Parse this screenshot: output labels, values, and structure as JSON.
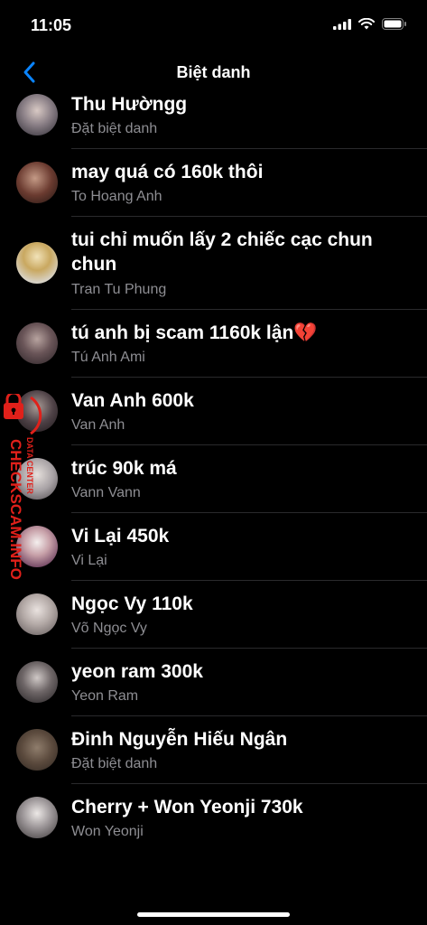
{
  "status_bar": {
    "time": "11:05"
  },
  "header": {
    "title": "Biệt danh"
  },
  "contacts": [
    {
      "nickname": "Thu Hườngg",
      "subtitle": "Đặt biệt danh"
    },
    {
      "nickname": "may quá có 160k thôi",
      "subtitle": "To Hoang Anh"
    },
    {
      "nickname": "tui chỉ muốn lấy 2 chiếc cạc chun chun",
      "subtitle": "Tran Tu Phung"
    },
    {
      "nickname": "tú anh bị scam 1160k lận",
      "emoji": "💔",
      "subtitle": "Tú Anh Ami"
    },
    {
      "nickname": "Van Anh 600k",
      "subtitle": "Van Anh"
    },
    {
      "nickname": "trúc 90k má",
      "subtitle": "Vann Vann"
    },
    {
      "nickname": "Vi Lại 450k",
      "subtitle": "Vi Lại"
    },
    {
      "nickname": "Ngọc Vy 110k",
      "subtitle": "Võ Ngọc Vy"
    },
    {
      "nickname": "yeon ram 300k",
      "subtitle": "Yeon Ram"
    },
    {
      "nickname": "Đinh Nguyễn Hiếu Ngân",
      "subtitle": "Đặt biệt danh"
    },
    {
      "nickname": "Cherry + Won Yeonji 730k",
      "subtitle": "Won Yeonji"
    }
  ],
  "watermark": {
    "line1": "CHECKSCAM.INFO",
    "line2": "DATA CENTER"
  },
  "colors": {
    "background": "#000000",
    "accent": "#0a84ff",
    "secondary_text": "#8e8e93",
    "watermark": "#e0201a"
  }
}
